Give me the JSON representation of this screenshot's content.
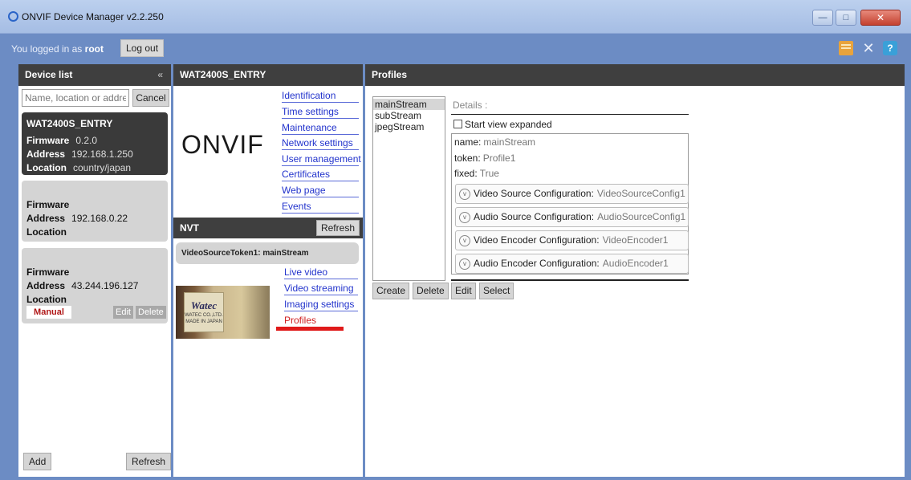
{
  "window": {
    "title": "ONVIF Device Manager v2.2.250",
    "min": "—",
    "max": "□",
    "close": "✕"
  },
  "topbar": {
    "logged_prefix": "You logged in as",
    "user": "root",
    "logout": "Log out"
  },
  "device_list": {
    "title": "Device list",
    "collapse": "«",
    "search_placeholder": "Name, location or address",
    "cancel": "Cancel",
    "devices": [
      {
        "name": "WAT2400S_ENTRY",
        "firmware_label": "Firmware",
        "firmware": "0.2.0",
        "address_label": "Address",
        "address": "192.168.1.250",
        "location_label": "Location",
        "location": "country/japan"
      },
      {
        "firmware_label": "Firmware",
        "address_label": "Address",
        "address": "192.168.0.22",
        "location_label": "Location"
      },
      {
        "firmware_label": "Firmware",
        "address_label": "Address",
        "address": "43.244.196.127",
        "location_label": "Location",
        "badge": "Manual",
        "edit": "Edit",
        "delete": "Delete"
      }
    ],
    "add": "Add",
    "refresh": "Refresh"
  },
  "device_panel": {
    "title": "WAT2400S_ENTRY",
    "logo": "ONVIF",
    "menu": [
      "Identification",
      "Time settings",
      "Maintenance",
      "Network settings",
      "User management",
      "Certificates",
      "Web page",
      "Events"
    ],
    "nvt_title": "NVT",
    "nvt_refresh": "Refresh",
    "stream_tab": "VideoSourceToken1: mainStream",
    "thumb_brand": "Watec",
    "thumb_sub1": "WATEC CO.,LTD.",
    "thumb_sub2": "MADE IN JAPAN",
    "nvt_menu": [
      "Live video",
      "Video streaming",
      "Imaging settings",
      "Profiles"
    ]
  },
  "profiles": {
    "title": "Profiles",
    "list": [
      "mainStream",
      "subStream",
      "jpegStream"
    ],
    "details_label": "Details :",
    "start_expanded": "Start view expanded",
    "name_label": "name:",
    "name": "mainStream",
    "token_label": "token:",
    "token": "Profile1",
    "fixed_label": "fixed:",
    "fixed": "True",
    "configs": [
      {
        "label": "Video Source Configuration:",
        "value": "VideoSourceConfig1"
      },
      {
        "label": "Audio Source Configuration:",
        "value": "AudioSourceConfig1"
      },
      {
        "label": "Video Encoder Configuration:",
        "value": "VideoEncoder1"
      },
      {
        "label": "Audio Encoder Configuration:",
        "value": "AudioEncoder1"
      }
    ],
    "actions": [
      "Create",
      "Delete",
      "Edit",
      "Select"
    ]
  }
}
